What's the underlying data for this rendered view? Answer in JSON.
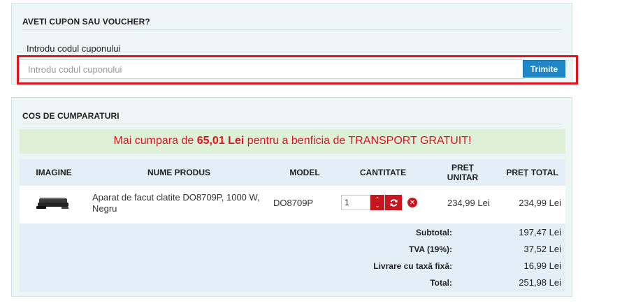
{
  "coupon": {
    "title": "AVETI CUPON SAU VOUCHER?",
    "label": "Introdu codul cuponului",
    "input_value": "",
    "placeholder": "Introdu codul cuponului",
    "submit_label": "Trimite"
  },
  "cart": {
    "title": "COS DE CUMPARATURI",
    "notice": {
      "prefix": "Mai cumpara de ",
      "amount": "65,01 Lei",
      "suffix": " pentru a benficia de TRANSPORT GRATUIT!"
    },
    "columns": {
      "image": "IMAGINE",
      "name": "NUME PRODUS",
      "model": "MODEL",
      "quantity": "CANTITATE",
      "unit_price_line1": "PREȚ",
      "unit_price_line2": "UNITAR",
      "total_price": "PREȚ TOTAL"
    },
    "items": [
      {
        "name": "Aparat de facut clatite DO8709P, 1000 W, Negru",
        "model": "DO8709P",
        "quantity": "1",
        "unit_price": "234,99 Lei",
        "total_price": "234,99 Lei",
        "image_icon": "crepe-maker-product-image"
      }
    ],
    "totals": [
      {
        "label": "Subtotal:",
        "value": "197,47 Lei"
      },
      {
        "label": "TVA (19%):",
        "value": "37,52 Lei"
      },
      {
        "label": "Livrare cu taxă fixă:",
        "value": "16,99 Lei"
      },
      {
        "label": "Total:",
        "value": "251,98 Lei"
      }
    ]
  },
  "colors": {
    "panel_bg": "#eef5f5",
    "accent_blue": "#1f86c8",
    "accent_red": "#c9151d",
    "notice_bg": "#dff0d8",
    "highlight": "#e0141e"
  }
}
